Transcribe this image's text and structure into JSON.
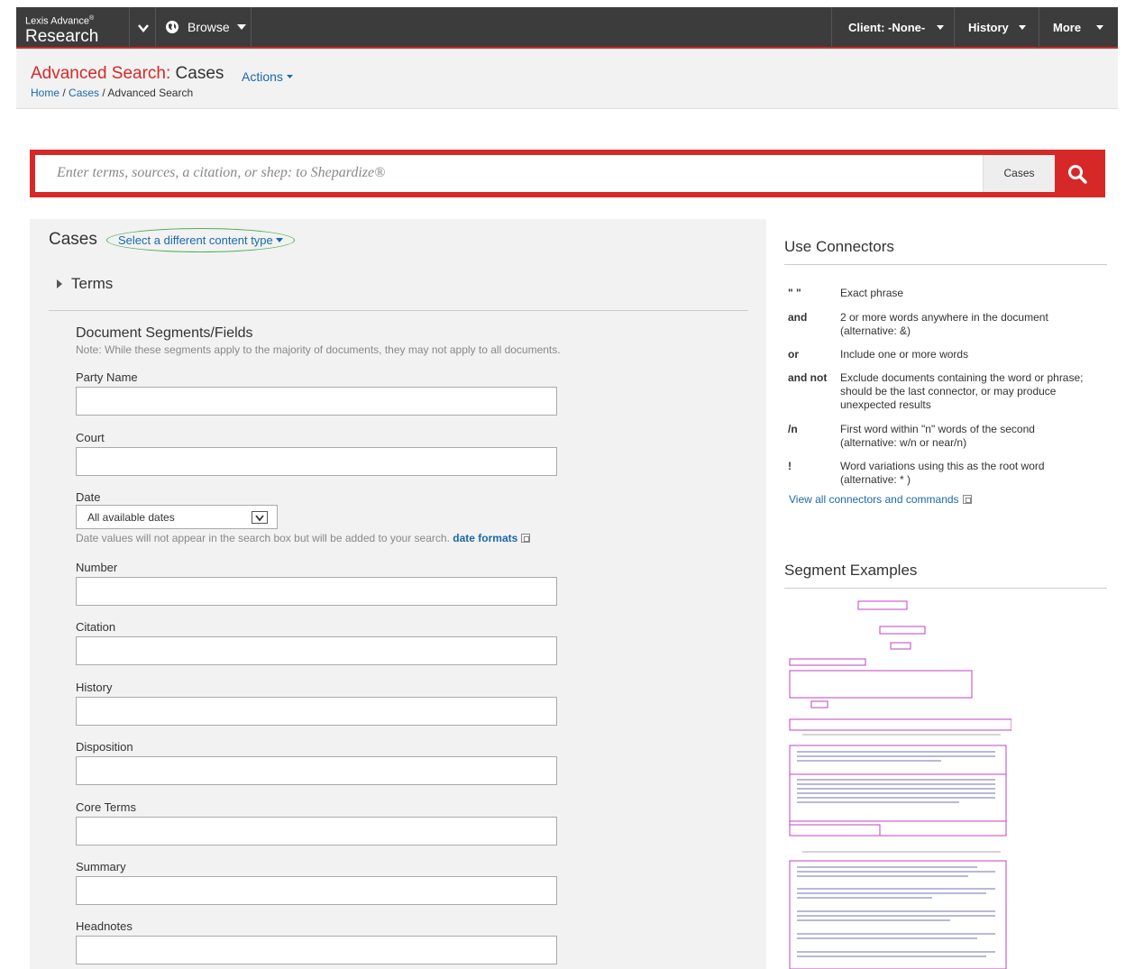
{
  "app": {
    "brand_small": "Lexis Advance",
    "brand_reg": "®",
    "brand_big": "Research"
  },
  "nav": {
    "browse": "Browse",
    "client": "Client: -None-",
    "history": "History",
    "more": "More"
  },
  "header": {
    "title_part1": "Advanced Search:",
    "title_part2": "Cases",
    "actions": "Actions",
    "breadcrumb": {
      "home": "Home",
      "sep1": "/",
      "cases": "Cases",
      "sep2": "/",
      "current": "Advanced Search"
    }
  },
  "search": {
    "placeholder": "Enter terms, sources, a citation, or shep: to Shepardize®",
    "content_type": "Cases"
  },
  "left": {
    "heading": "Cases",
    "different_type": "Select a different content type",
    "terms": "Terms",
    "segments_title": "Document Segments/Fields",
    "segments_note": "Note: While these segments apply to the majority of documents, they may not apply to all documents.",
    "fields": {
      "party_name": "Party Name",
      "court": "Court",
      "date": "Date",
      "number": "Number",
      "citation": "Citation",
      "history": "History",
      "disposition": "Disposition",
      "core_terms": "Core Terms",
      "summary": "Summary",
      "headnotes": "Headnotes"
    },
    "date_value": "All available dates",
    "date_note": "Date values will not appear in the search box but will be added to your search.",
    "date_formats": "date formats"
  },
  "right": {
    "connectors_title": "Use Connectors",
    "connectors": [
      {
        "key": "\" \"",
        "desc": "Exact phrase"
      },
      {
        "key": "and",
        "desc": "2 or more words anywhere in the document (alternative: &)"
      },
      {
        "key": "or",
        "desc": "Include one or more words"
      },
      {
        "key": "and not",
        "desc": "Exclude documents containing the word or phrase; should be the last connector, or may produce unexpected results"
      },
      {
        "key": "/n",
        "desc": "First word within \"n\" words of the second (alternative: w/n or near/n)"
      },
      {
        "key": "!",
        "desc": "Word variations using this as the root word (alternative: * )"
      }
    ],
    "view_all": "View all connectors and commands",
    "segment_examples_title": "Segment Examples"
  },
  "colors": {
    "brand_red": "#d72828",
    "link_blue": "#1a6aa8",
    "nav_bg": "#3c3c3c",
    "panel_bg": "#f2f2f2"
  }
}
